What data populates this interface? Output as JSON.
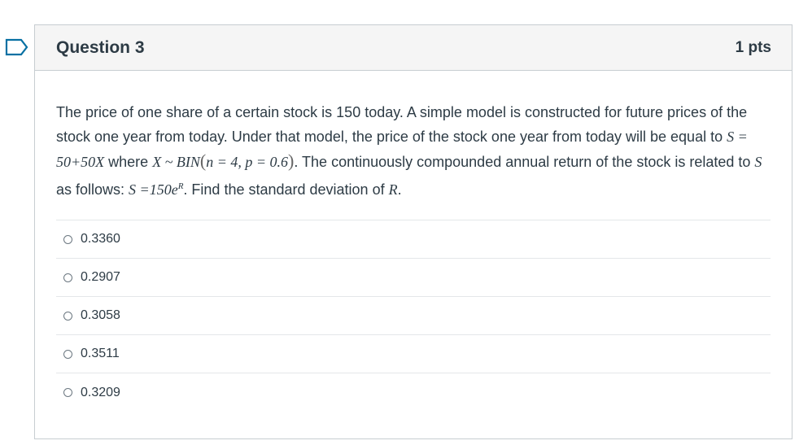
{
  "question": {
    "title": "Question 3",
    "points": "1 pts",
    "text": {
      "part1": "The price of one share of a certain stock is 150 today. A simple model is constructed for future prices of the stock one year from today. Under that model, the price of the stock one year from today will be equal to ",
      "math1": "S = 50+50X",
      "part2": " where ",
      "math2_head": "X ~ BIN",
      "math2_args": "n = 4, p = 0.6",
      "part3": ". The continuously compounded annual return of the stock is related to ",
      "math3": "S",
      "part4": " as follows: ",
      "math4_base": "S =150e",
      "math4_sup": "R",
      "part5": ". Find the standard deviation of ",
      "math5": "R",
      "part6": "."
    },
    "answers": [
      {
        "label": "0.3360"
      },
      {
        "label": "0.2907"
      },
      {
        "label": "0.3058"
      },
      {
        "label": "0.3511"
      },
      {
        "label": "0.3209"
      }
    ]
  },
  "colors": {
    "accent": "#0770a3",
    "text": "#2d3b45",
    "header_bg": "#f5f5f5",
    "border": "#c7cdd1"
  },
  "icons": {
    "flag": "bookmark-flag-icon",
    "radio": "radio-unchecked-icon"
  }
}
